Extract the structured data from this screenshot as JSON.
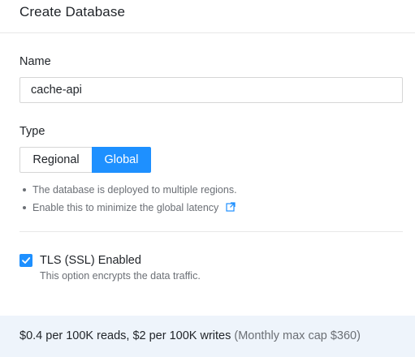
{
  "dialog": {
    "title": "Create Database"
  },
  "name_field": {
    "label": "Name",
    "value": "cache-api"
  },
  "type_field": {
    "label": "Type",
    "options": [
      "Regional",
      "Global"
    ],
    "selected": "Global",
    "notes": [
      "The database is deployed to multiple regions.",
      "Enable this to minimize the global latency"
    ],
    "note_link_icon": "external-link-icon"
  },
  "tls": {
    "checked": true,
    "label": "TLS (SSL) Enabled",
    "description": "This option encrypts the data traffic."
  },
  "pricing": {
    "text": "$0.4 per 100K reads, $2 per 100K writes",
    "cap": "(Monthly max cap $360)"
  },
  "colors": {
    "accent": "#1e90ff",
    "footer_bg": "#eef4fb",
    "muted_text": "#6b6f75"
  }
}
